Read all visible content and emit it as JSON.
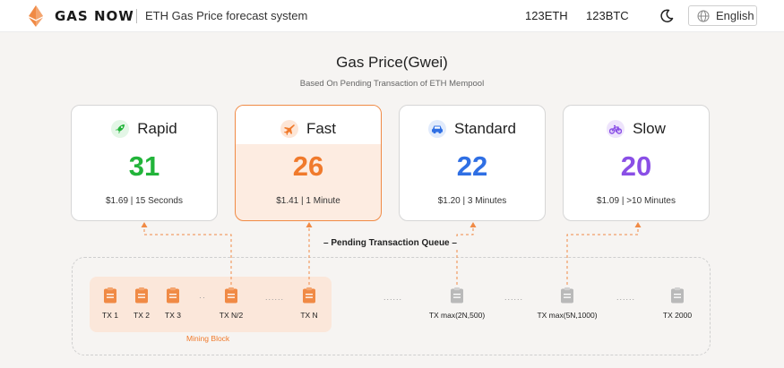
{
  "header": {
    "brand": "GAS NOW",
    "tagline": "ETH Gas Price forecast system",
    "price_eth": "123ETH",
    "price_btc": "123BTC",
    "language": "English"
  },
  "page": {
    "title": "Gas Price(Gwei)",
    "subtitle": "Based On Pending Transaction of ETH Mempool"
  },
  "cards": [
    {
      "label": "Rapid",
      "value": "31",
      "info": "$1.69 | 15 Seconds",
      "color": "#22b43a",
      "icon_bg": "#e3f6e6",
      "icon": "rocket-icon"
    },
    {
      "label": "Fast",
      "value": "26",
      "info": "$1.41 | 1 Minute",
      "color": "#f07a2c",
      "icon_bg": "#fde6d7",
      "icon": "airplane-icon"
    },
    {
      "label": "Standard",
      "value": "22",
      "info": "$1.20 | 3 Minutes",
      "color": "#2f6fe4",
      "icon_bg": "#e1ebfc",
      "icon": "car-icon"
    },
    {
      "label": "Slow",
      "value": "20",
      "info": "$1.09 | >10 Minutes",
      "color": "#8a4fe6",
      "icon_bg": "#eee4fc",
      "icon": "bicycle-icon"
    }
  ],
  "queue": {
    "label": "Pending Transaction Queue",
    "mining_block": "Mining Block",
    "separator": "......",
    "tx": [
      "TX 1",
      "TX 2",
      "TX 3",
      "TX N/2",
      "TX N",
      "TX max(2N,500)",
      "TX max(5N,1000)",
      "TX 2000"
    ]
  },
  "colors": {
    "accent": "#f07a2c",
    "mined_tx": "#f08a45",
    "pending_tx": "#b9b9b9"
  }
}
